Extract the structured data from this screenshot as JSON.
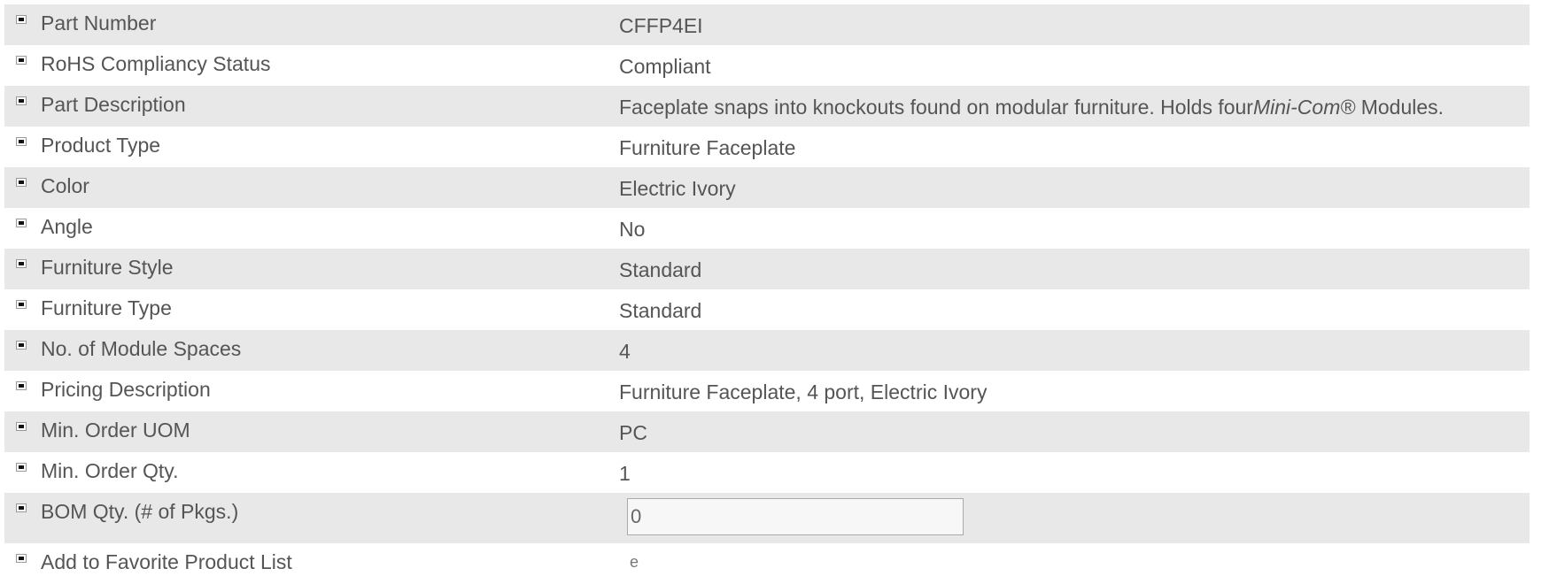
{
  "rows": [
    {
      "label": "Part Number",
      "value": "CFFP4EI"
    },
    {
      "label": "RoHS Compliancy Status",
      "value": "Compliant"
    },
    {
      "label": "Part Description",
      "value_prefix": "Faceplate snaps into knockouts found on modular furniture. Holds four",
      "value_italic": "Mini-Com®",
      "value_suffix": " Modules."
    },
    {
      "label": "Product Type",
      "value": "Furniture Faceplate"
    },
    {
      "label": "Color",
      "value": "Electric Ivory"
    },
    {
      "label": "Angle",
      "value": "No"
    },
    {
      "label": "Furniture Style",
      "value": "Standard"
    },
    {
      "label": "Furniture Type",
      "value": "Standard"
    },
    {
      "label": "No. of Module Spaces",
      "value": "4"
    },
    {
      "label": "Pricing Description",
      "value": "Furniture Faceplate, 4 port, Electric Ivory"
    },
    {
      "label": "Min. Order UOM",
      "value": "PC"
    },
    {
      "label": "Min. Order Qty.",
      "value": "1"
    },
    {
      "label": "BOM Qty. (# of Pkgs.)",
      "input_value": "0"
    },
    {
      "label": "Add to Favorite Product List",
      "toggle_glyph": "e"
    }
  ],
  "colors": {
    "row_shade": "#e8e8e8",
    "text": "#555555"
  },
  "icons": {
    "bullet": "square-bullet-icon"
  }
}
